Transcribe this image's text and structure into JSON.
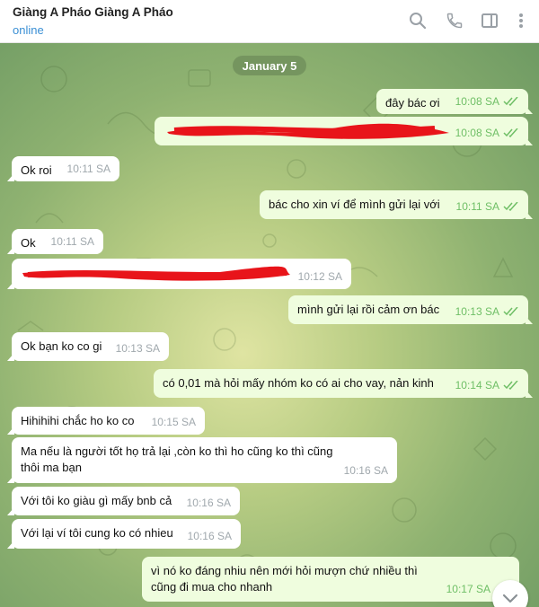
{
  "header": {
    "title": "Giàng A Pháo Giàng A Pháo",
    "status": "online",
    "icons": [
      "search-icon",
      "phone-icon",
      "sidebar-icon",
      "more-icon"
    ]
  },
  "chat": {
    "date": "January 5",
    "messages": [
      {
        "dir": "out",
        "text": "đây bác ơi",
        "time": "10:08 SA",
        "read": true
      },
      {
        "dir": "out",
        "text": "",
        "redacted": true,
        "time": "10:08 SA",
        "read": true
      },
      {
        "dir": "in",
        "text": "Ok roi",
        "time": "10:11 SA"
      },
      {
        "dir": "out",
        "text": "bác cho xin ví để mình gửi lại với",
        "time": "10:11 SA",
        "read": true
      },
      {
        "dir": "in",
        "text": "Ok",
        "time": "10:11 SA"
      },
      {
        "dir": "in",
        "text": "",
        "redacted": true,
        "time": "10:12 SA"
      },
      {
        "dir": "out",
        "text": "mình gửi lại rồi cảm ơn bác",
        "time": "10:13 SA",
        "read": true
      },
      {
        "dir": "in",
        "text": "Ok bạn ko co gi",
        "time": "10:13 SA"
      },
      {
        "dir": "out",
        "text": "có 0,01 mà hỏi mấy nhóm ko có ai cho vay, nản kinh",
        "time": "10:14 SA",
        "read": true
      },
      {
        "dir": "in",
        "text": "Hihihihi chắc ho ko co",
        "time": "10:15 SA"
      },
      {
        "dir": "in",
        "text": "Ma nếu là người tốt họ trả lại ,còn ko thì ho cũng ko thì cũng thôi ma bạn",
        "time": "10:16 SA"
      },
      {
        "dir": "in",
        "text": "Với tôi ko giàu gì mấy bnb cả",
        "time": "10:16 SA"
      },
      {
        "dir": "in",
        "text": "Với lại ví tôi cung ko có nhieu",
        "time": "10:16 SA"
      },
      {
        "dir": "out",
        "text": "vì nó ko đáng nhiu nên mới hỏi mượn chứ nhiều thì cũng đi mua cho nhanh",
        "time": "10:17 SA",
        "read": true
      }
    ]
  },
  "colors": {
    "accent": "#3a8fd4",
    "outgoing_bubble": "#effdde",
    "check": "#6fbf66",
    "redaction": "#e8141a"
  },
  "scroll_button_icon": "chevron-down-icon"
}
